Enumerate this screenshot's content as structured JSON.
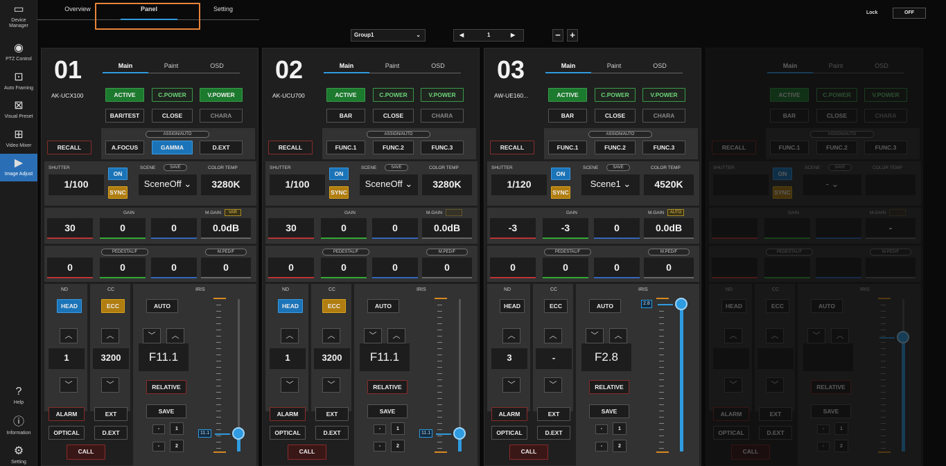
{
  "sidebar": {
    "items": [
      {
        "label": "Device\nManager",
        "icon": "device-manager-icon"
      },
      {
        "label": "PTZ Control",
        "icon": "ptz-control-icon"
      },
      {
        "label": "Auto Framing",
        "icon": "auto-framing-icon"
      },
      {
        "label": "Visual Preset",
        "icon": "visual-preset-icon"
      },
      {
        "label": "Video Mixer",
        "icon": "video-mixer-icon"
      },
      {
        "label": "Image Adjust",
        "icon": "image-adjust-icon"
      },
      {
        "label": "Help",
        "icon": "help-icon"
      },
      {
        "label": "Information",
        "icon": "information-icon"
      },
      {
        "label": "Setting",
        "icon": "setting-icon"
      }
    ]
  },
  "top_tabs": [
    "Overview",
    "Panel",
    "Setting"
  ],
  "active_tab": "Panel",
  "lock": {
    "label": "Lock",
    "value": "OFF"
  },
  "group": {
    "selected": "Group1",
    "page": "1"
  },
  "accent": "#2f9be0",
  "panels": [
    {
      "number": "01",
      "tabs": [
        "Main",
        "Paint",
        "OSD"
      ],
      "model": "AK-UCX100",
      "row1": [
        "ACTIVE",
        "C.POWER",
        "V.POWER"
      ],
      "row2": [
        "BAR/TEST",
        "CLOSE",
        "CHARA"
      ],
      "assign": "ASSIGN/AUTO",
      "recall": "RECALL",
      "func": [
        "A.FOCUS",
        "GAMMA",
        "D.EXT"
      ],
      "shutter_label": "SHUTTER",
      "on": "ON",
      "sync": "SYNC",
      "shutter": "1/100",
      "scene_label": "SCENE",
      "scene_save": "SAVE",
      "scene": "SceneOff ⌄",
      "ct_label": "COLOR TEMP",
      "ct": "3280K",
      "gain_label": "GAIN",
      "mgain_label": "M.GAIN",
      "mgain_tag": "VAR",
      "gain": [
        "30",
        "0",
        "0"
      ],
      "mgain": "0.0dB",
      "ped_label": "PEDESTAL/F",
      "mped_label": "M.PED/F",
      "ped": [
        "0",
        "0",
        "0"
      ],
      "mped": "0",
      "nd_label": "ND",
      "cc_label": "CC",
      "iris_label": "IRIS",
      "nd_mode": "HEAD",
      "cc_mode": "ECC",
      "iris_auto": "AUTO",
      "nd": "1",
      "cc": "3200",
      "iris": "F11.1",
      "relative": "RELATIVE",
      "save": "SAVE",
      "alarm": "ALARM",
      "ext": "EXT",
      "optical": "OPTICAL",
      "dext": "D.EXT",
      "call": "CALL",
      "mem": [
        "1",
        "2"
      ],
      "iris_tag": "11.1",
      "iris_level": 0.12
    },
    {
      "number": "02",
      "tabs": [
        "Main",
        "Paint",
        "OSD"
      ],
      "model": "AK-UCU700",
      "row1": [
        "ACTIVE",
        "C.POWER",
        "V.POWER"
      ],
      "row2": [
        "BAR",
        "CLOSE",
        "CHARA"
      ],
      "assign": "ASSIGN/AUTO",
      "recall": "RECALL",
      "func": [
        "FUNC.1",
        "FUNC.2",
        "FUNC.3"
      ],
      "shutter_label": "SHUTTER",
      "on": "ON",
      "sync": "SYNC",
      "shutter": "1/100",
      "scene_label": "SCENE",
      "scene_save": "SAVE",
      "scene": "SceneOff ⌄",
      "ct_label": "COLOR TEMP",
      "ct": "3280K",
      "gain_label": "GAIN",
      "mgain_label": "M.GAIN",
      "mgain_tag": "",
      "gain": [
        "30",
        "0",
        "0"
      ],
      "mgain": "0.0dB",
      "ped_label": "PEDESTAL/F",
      "mped_label": "M.PED/F",
      "ped": [
        "0",
        "0",
        "0"
      ],
      "mped": "0",
      "nd_label": "ND",
      "cc_label": "CC",
      "iris_label": "IRIS",
      "nd_mode": "HEAD",
      "cc_mode": "ECC",
      "iris_auto": "AUTO",
      "nd": "1",
      "cc": "3200",
      "iris": "F11.1",
      "relative": "RELATIVE",
      "save": "SAVE",
      "alarm": "ALARM",
      "ext": "EXT",
      "optical": "OPTICAL",
      "dext": "D.EXT",
      "call": "CALL",
      "mem": [
        "1",
        "2"
      ],
      "iris_tag": "11.1",
      "iris_level": 0.12
    },
    {
      "number": "03",
      "tabs": [
        "Main",
        "Paint",
        "OSD"
      ],
      "model": "AW-UE160...",
      "row1": [
        "ACTIVE",
        "C.POWER",
        "V.POWER"
      ],
      "row2": [
        "BAR",
        "CLOSE",
        "CHARA"
      ],
      "assign": "ASSIGN/AUTO",
      "recall": "RECALL",
      "func": [
        "FUNC.1",
        "FUNC.2",
        "FUNC.3"
      ],
      "shutter_label": "SHUTTER",
      "on": "ON",
      "sync": "SYNC",
      "shutter": "1/120",
      "scene_label": "SCENE",
      "scene_save": "SAVE",
      "scene": "Scene1 ⌄",
      "ct_label": "COLOR TEMP",
      "ct": "4520K",
      "gain_label": "GAIN",
      "mgain_label": "M.GAIN",
      "mgain_tag": "AUTO",
      "gain": [
        "-3",
        "-3",
        "0"
      ],
      "mgain": "0.0dB",
      "ped_label": "PEDESTAL/F",
      "mped_label": "M.PED/F",
      "ped": [
        "0",
        "0",
        "0"
      ],
      "mped": "0",
      "nd_label": "ND",
      "cc_label": "CC",
      "iris_label": "IRIS",
      "nd_mode": "HEAD",
      "cc_mode": "ECC",
      "iris_auto": "AUTO",
      "nd": "3",
      "cc": "-",
      "iris": "F2.8",
      "relative": "RELATIVE",
      "save": "SAVE",
      "alarm": "ALARM",
      "ext": "EXT",
      "optical": "OPTICAL",
      "dext": "D.EXT",
      "call": "CALL",
      "mem": [
        "1",
        "2"
      ],
      "iris_tag": "2.8",
      "iris_level": 0.97
    },
    {
      "number": "",
      "tabs": [
        "Main",
        "Paint",
        "OSD"
      ],
      "model": "",
      "row1": [
        "ACTIVE",
        "C.POWER",
        "V.POWER"
      ],
      "row2": [
        "BAR",
        "CLOSE",
        "CHARA"
      ],
      "assign": "ASSIGN/AUTO",
      "recall": "RECALL",
      "func": [
        "FUNC.1",
        "FUNC.2",
        "FUNC.3"
      ],
      "shutter_label": "SHUTTER",
      "on": "ON",
      "sync": "SYNC",
      "shutter": "",
      "scene_label": "SCENE",
      "scene_save": "SAVE",
      "scene": "- ⌄",
      "ct_label": "COLOR TEMP",
      "ct": "",
      "gain_label": "GAIN",
      "mgain_label": "M.GAIN",
      "mgain_tag": "",
      "gain": [
        "",
        "",
        ""
      ],
      "mgain": "-",
      "ped_label": "PEDESTAL/F",
      "mped_label": "M.PED/F",
      "ped": [
        "",
        "",
        ""
      ],
      "mped": "",
      "nd_label": "ND",
      "cc_label": "CC",
      "iris_label": "IRIS",
      "nd_mode": "HEAD",
      "cc_mode": "ECC",
      "iris_auto": "AUTO",
      "nd": "",
      "cc": "",
      "iris": "",
      "relative": "RELATIVE",
      "save": "SAVE",
      "alarm": "ALARM",
      "ext": "EXT",
      "optical": "OPTICAL",
      "dext": "D.EXT",
      "call": "CALL",
      "mem": [
        "1",
        "2"
      ],
      "iris_tag": "",
      "iris_level": 0.75
    }
  ]
}
